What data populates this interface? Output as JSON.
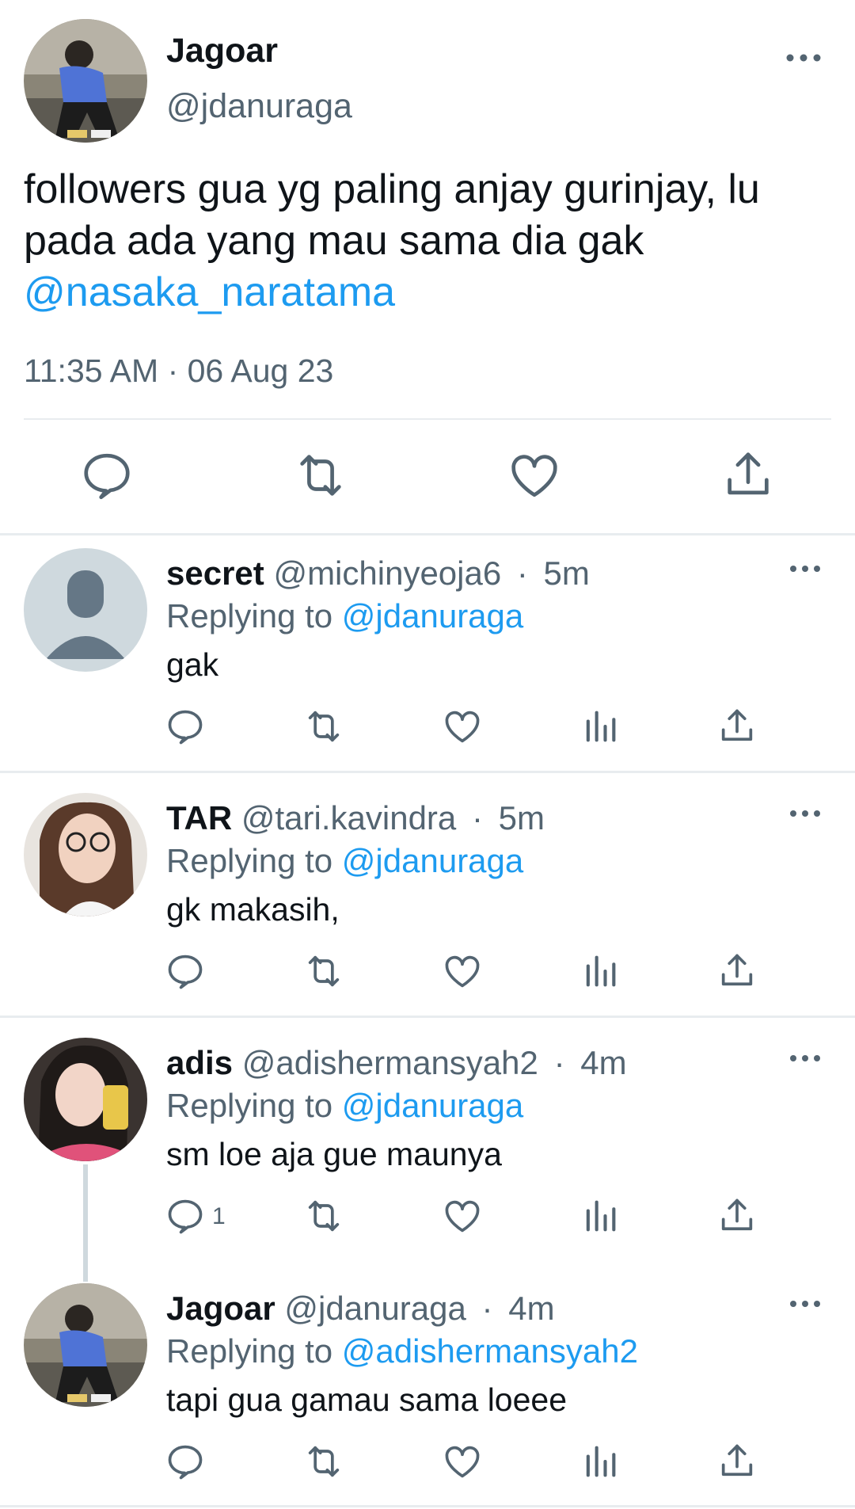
{
  "main_tweet": {
    "display_name": "Jagoar",
    "handle": "@jdanuraga",
    "text_line1": "followers gua yg paling anjay gurinjay, lu",
    "text_line2": "pada ada yang mau sama dia gak",
    "mention": "@nasaka_naratama",
    "timestamp": "11:35 AM · 06 Aug 23",
    "avatar_icon": "user-photo-avatar",
    "actions": [
      "reply-icon",
      "retweet-icon",
      "like-icon",
      "share-icon"
    ]
  },
  "replies": [
    {
      "display_name": "secret",
      "handle": "@michinyeoja6",
      "time": "5m",
      "replying_prefix": "Replying to",
      "replying_to": "@jdanuraga",
      "text": "gak",
      "avatar": "default-avatar",
      "reply_count": ""
    },
    {
      "display_name": "TAR",
      "handle": "@tari.kavindra",
      "time": "5m",
      "replying_prefix": "Replying to",
      "replying_to": "@jdanuraga",
      "text": "gk makasih,",
      "avatar": "photo-avatar",
      "reply_count": ""
    },
    {
      "display_name": "adis",
      "handle": "@adishermansyah2",
      "time": "4m",
      "replying_prefix": "Replying to",
      "replying_to": "@jdanuraga",
      "text": "sm loe aja gue maunya",
      "avatar": "photo-avatar",
      "reply_count": "1"
    },
    {
      "display_name": "Jagoar",
      "handle": "@jdanuraga",
      "time": "4m",
      "replying_prefix": "Replying to",
      "replying_to": "@adishermansyah2",
      "text": "tapi gua gamau sama loeee",
      "avatar": "photo-avatar",
      "reply_count": ""
    }
  ],
  "colors": {
    "accent": "#1d9bf0",
    "secondary_text": "#536471",
    "primary_text": "#0f1419",
    "divider": "#e8ecef"
  }
}
